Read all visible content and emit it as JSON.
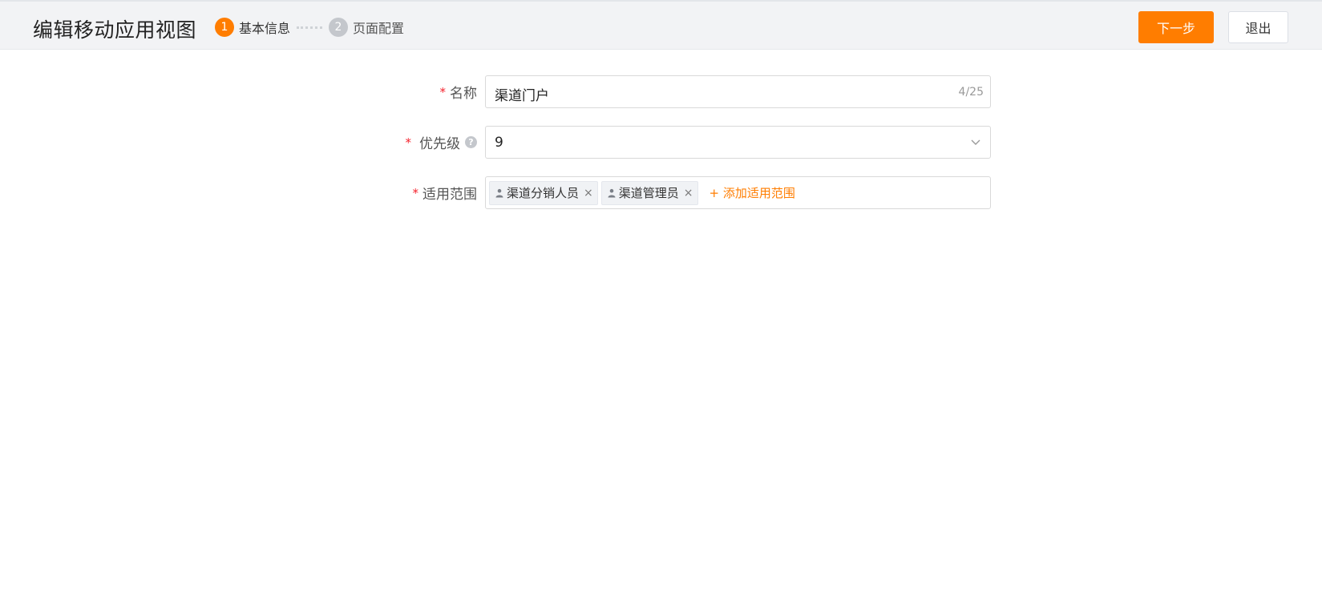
{
  "header": {
    "title": "编辑移动应用视图",
    "steps": [
      {
        "num": "1",
        "label": "基本信息",
        "state": "active"
      },
      {
        "num": "2",
        "label": "页面配置",
        "state": "inactive"
      }
    ],
    "next_label": "下一步",
    "exit_label": "退出"
  },
  "form": {
    "name": {
      "label": "名称",
      "required_mark": "*",
      "value": "渠道门户",
      "counter": "4/25"
    },
    "priority": {
      "label": "优先级",
      "required_mark": "*",
      "value": "9",
      "help_icon": "?"
    },
    "scope": {
      "label": "适用范围",
      "required_mark": "*",
      "tags": [
        {
          "label": "渠道分销人员",
          "icon": "person-icon",
          "close": "×"
        },
        {
          "label": "渠道管理员",
          "icon": "person-icon",
          "close": "×"
        }
      ],
      "add_label": "+ 添加适用范围"
    }
  },
  "colors": {
    "accent": "#ff7d00",
    "required": "#f5222d",
    "header_bg": "#f2f3f5"
  }
}
